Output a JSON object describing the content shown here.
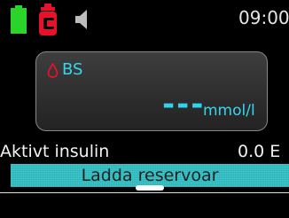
{
  "status_bar": {
    "time": "09:00",
    "battery_color": "#2bd42b",
    "reservoir_color": "#e8102a",
    "icons": [
      "battery-icon",
      "reservoir-icon",
      "speaker-icon"
    ]
  },
  "bg_card": {
    "label": "BS",
    "value": "---",
    "unit": "mmol/l",
    "drop_icon": "blood-drop-icon",
    "accent_color": "#2ed3ee"
  },
  "active_insulin": {
    "label": "Aktivt insulin",
    "value": "0.0 E"
  },
  "action_button": {
    "label": "Ladda reservoar",
    "color": "#2fc4c8"
  }
}
